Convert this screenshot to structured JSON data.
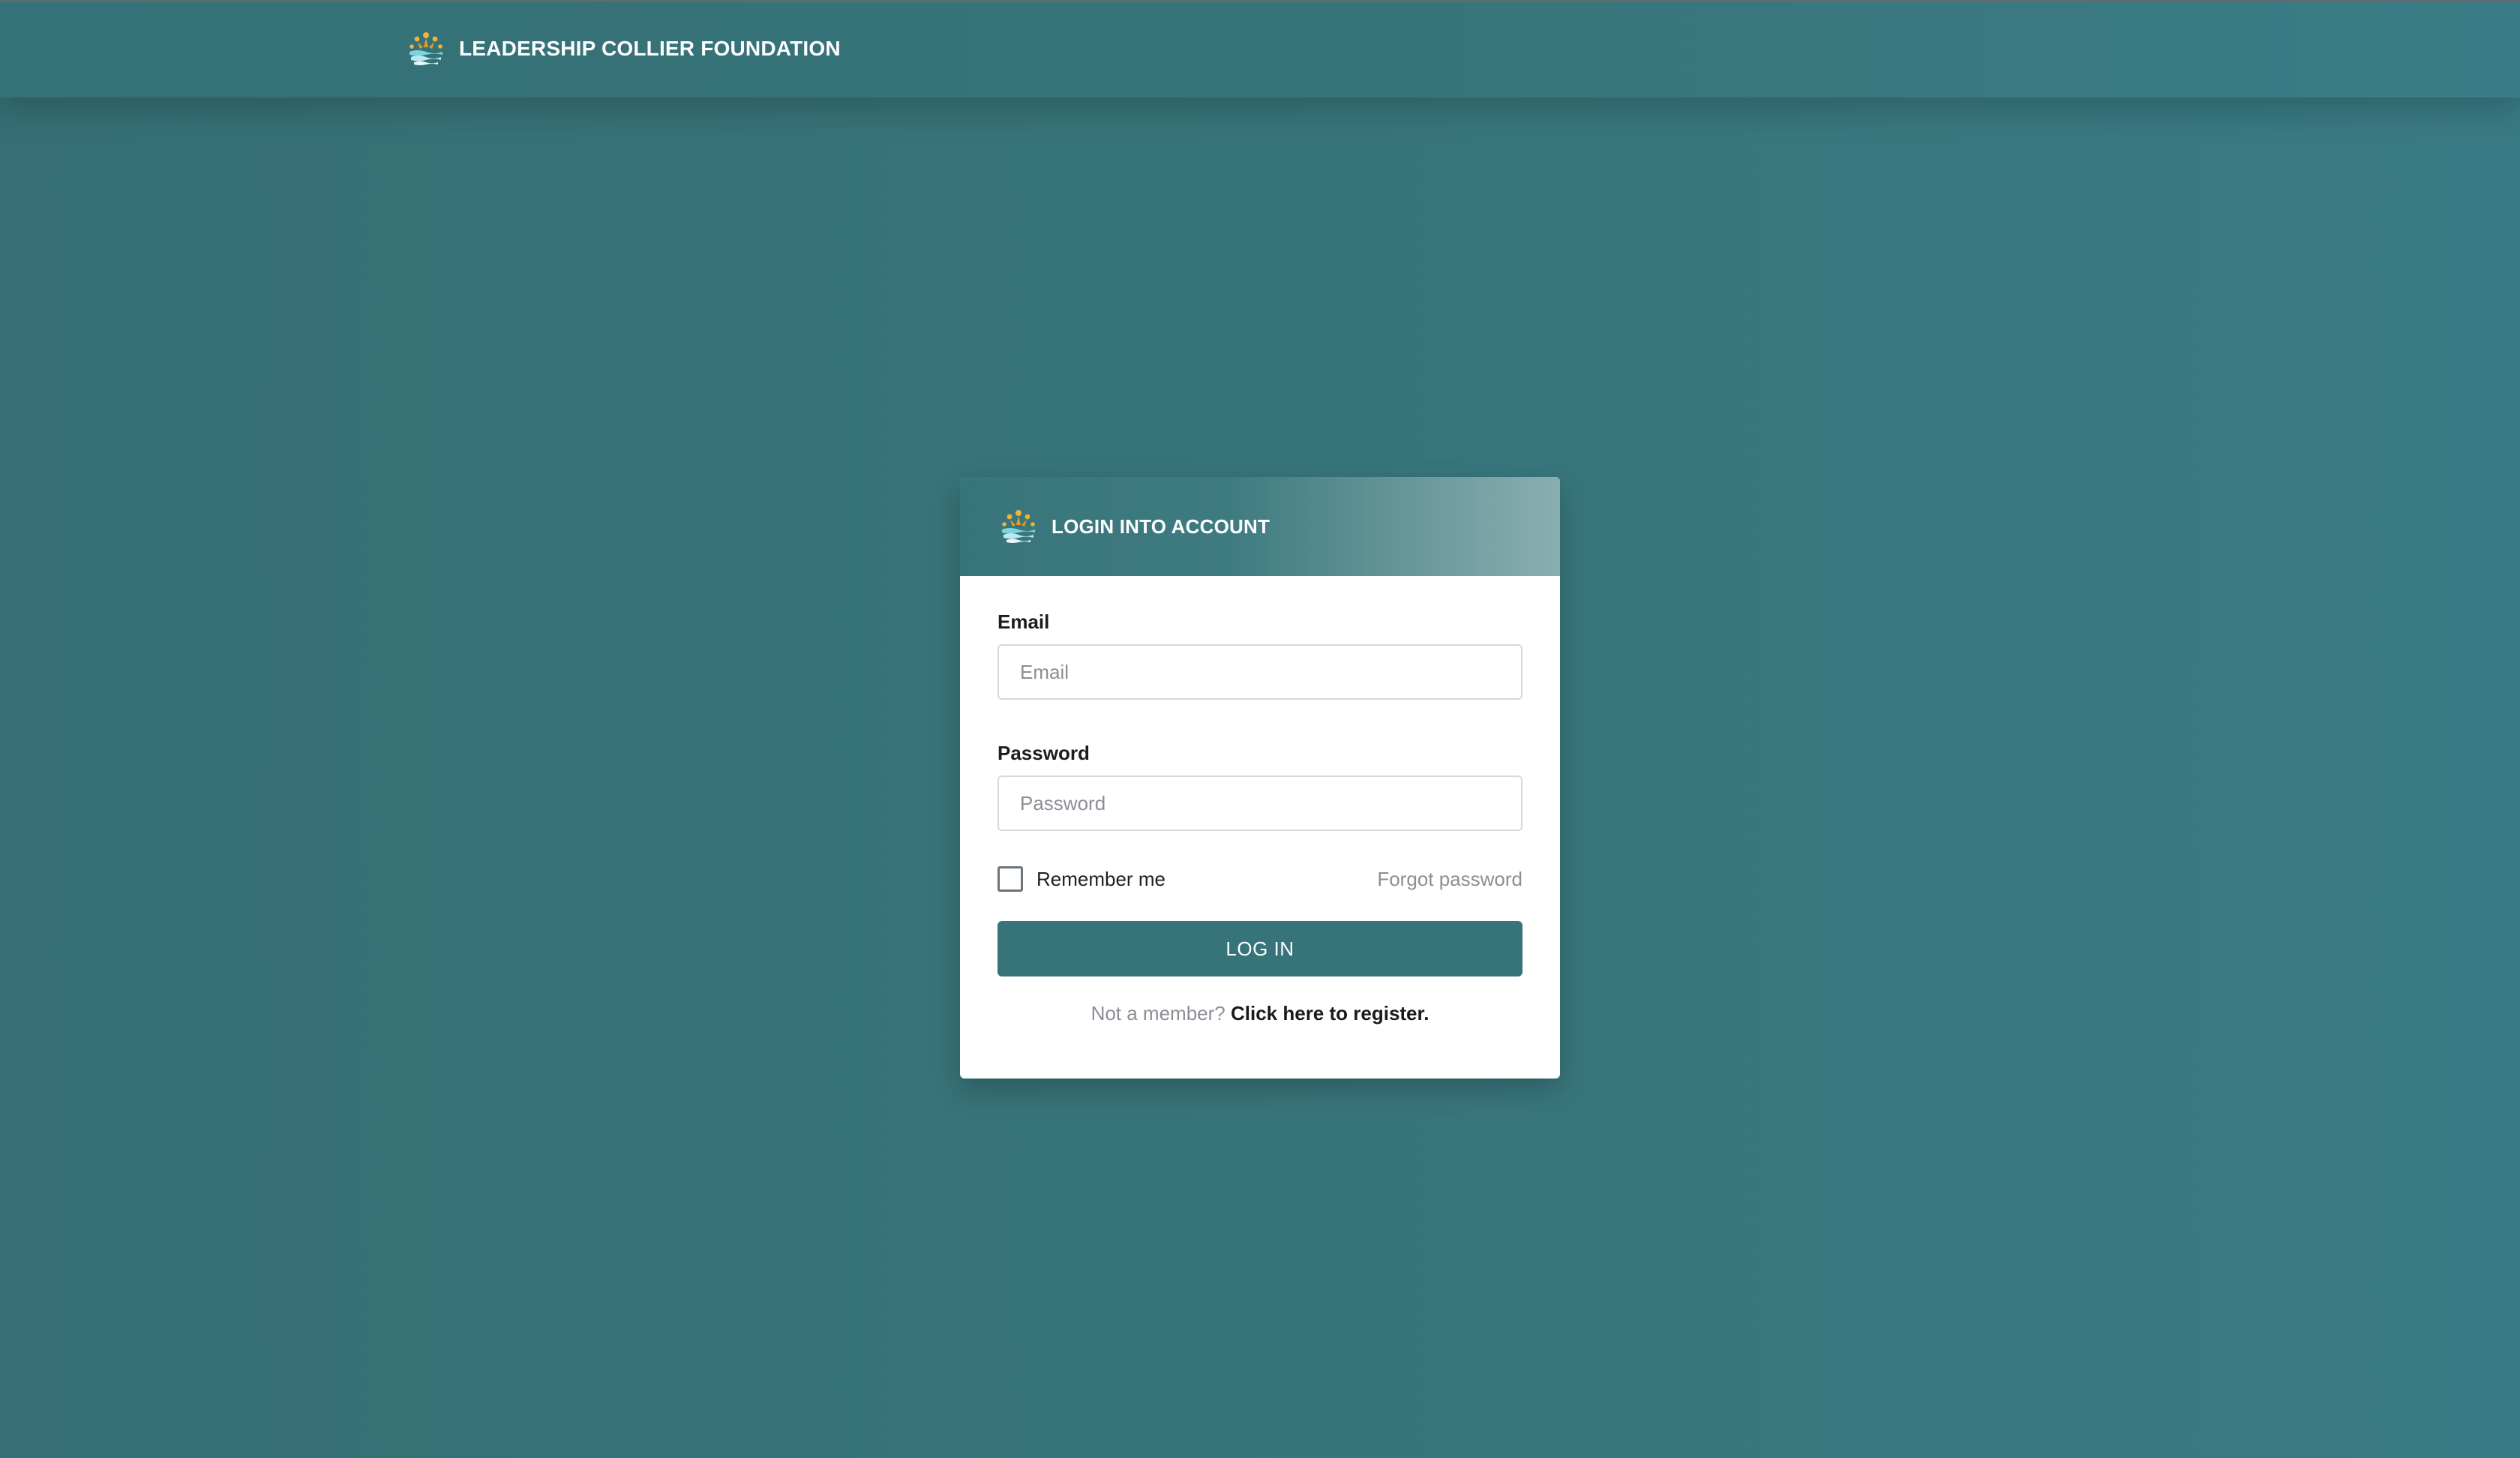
{
  "app": {
    "brand_title": "LEADERSHIP COLLIER FOUNDATION",
    "logo_icon": "foundation-logo-icon"
  },
  "login": {
    "card_title": "LOGIN INTO ACCOUNT",
    "email_label": "Email",
    "email_placeholder": "Email",
    "email_value": "",
    "password_label": "Password",
    "password_placeholder": "Password",
    "password_value": "",
    "remember_label": "Remember me",
    "remember_checked": false,
    "forgot_label": "Forgot password",
    "submit_label": "LOG IN",
    "register_prompt": "Not a member?",
    "register_link": "Click here to register."
  },
  "colors": {
    "background": "#377479",
    "accent": "#377479",
    "card": "#ffffff",
    "muted_text": "#8a8f95"
  }
}
